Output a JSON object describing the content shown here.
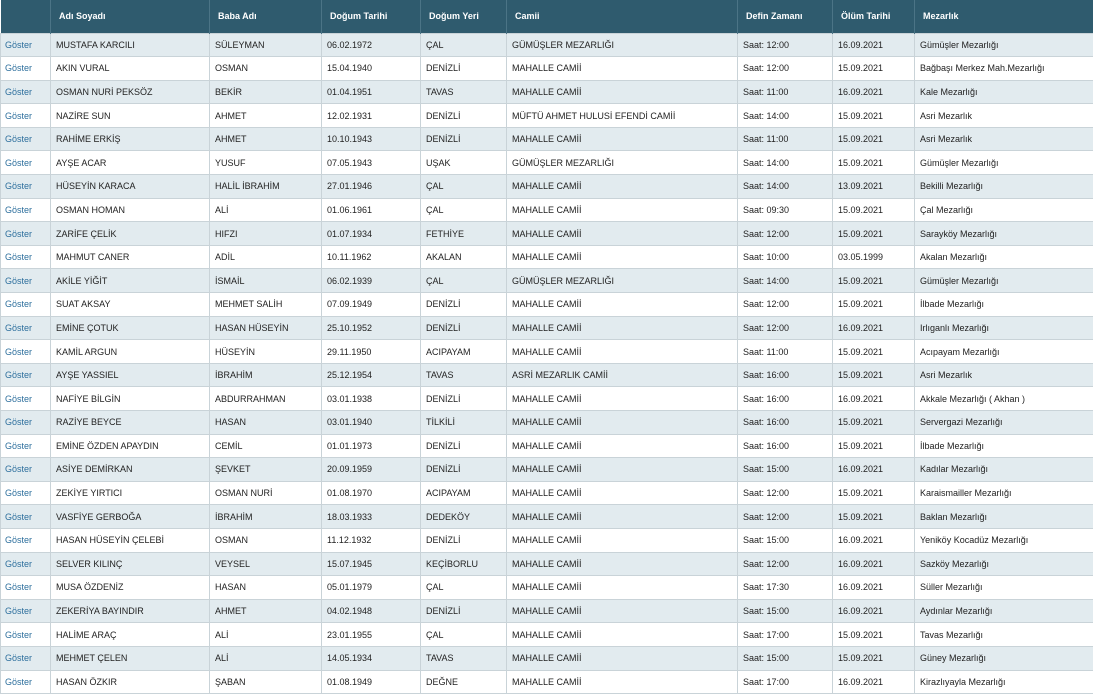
{
  "table": {
    "headers": [
      "",
      "Adı Soyadı",
      "Baba Adı",
      "Doğum Tarihi",
      "Doğum Yeri",
      "Camii",
      "Defin Zamanı",
      "Ölüm Tarihi",
      "Mezarlık"
    ],
    "link_label": "Göster",
    "rows": [
      [
        "MUSTAFA KARCILI",
        "SÜLEYMAN",
        "06.02.1972",
        "ÇAL",
        "GÜMÜŞLER MEZARLIĞI",
        "Saat: 12:00",
        "16.09.2021",
        "Gümüşler Mezarlığı"
      ],
      [
        "AKIN VURAL",
        "OSMAN",
        "15.04.1940",
        "DENİZLİ",
        "MAHALLE CAMİİ",
        "Saat: 12:00",
        "15.09.2021",
        "Bağbaşı Merkez Mah.Mezarlığı"
      ],
      [
        "OSMAN NURİ PEKSÖZ",
        "BEKİR",
        "01.04.1951",
        "TAVAS",
        "MAHALLE CAMİİ",
        "Saat: 11:00",
        "16.09.2021",
        "Kale Mezarlığı"
      ],
      [
        "NAZİRE SUN",
        "AHMET",
        "12.02.1931",
        "DENİZLİ",
        "MÜFTÜ AHMET HULUSİ EFENDİ CAMİİ",
        "Saat: 14:00",
        "15.09.2021",
        "Asri Mezarlık"
      ],
      [
        "RAHİME ERKİŞ",
        "AHMET",
        "10.10.1943",
        "DENİZLİ",
        "MAHALLE CAMİİ",
        "Saat: 11:00",
        "15.09.2021",
        "Asri Mezarlık"
      ],
      [
        "AYŞE ACAR",
        "YUSUF",
        "07.05.1943",
        "UŞAK",
        "GÜMÜŞLER MEZARLIĞI",
        "Saat: 14:00",
        "15.09.2021",
        "Gümüşler Mezarlığı"
      ],
      [
        "HÜSEYİN KARACA",
        "HALİL İBRAHİM",
        "27.01.1946",
        "ÇAL",
        "MAHALLE CAMİİ",
        "Saat: 14:00",
        "13.09.2021",
        "Bekilli Mezarlığı"
      ],
      [
        "OSMAN HOMAN",
        "ALİ",
        "01.06.1961",
        "ÇAL",
        "MAHALLE CAMİİ",
        "Saat: 09:30",
        "15.09.2021",
        "Çal Mezarlığı"
      ],
      [
        "ZARİFE ÇELİK",
        "HIFZI",
        "01.07.1934",
        "FETHİYE",
        "MAHALLE CAMİİ",
        "Saat: 12:00",
        "15.09.2021",
        "Sarayköy Mezarlığı"
      ],
      [
        "MAHMUT CANER",
        "ADİL",
        "10.11.1962",
        "AKALAN",
        "MAHALLE CAMİİ",
        "Saat: 10:00",
        "03.05.1999",
        "Akalan Mezarlığı"
      ],
      [
        "AKİLE YİĞİT",
        "İSMAİL",
        "06.02.1939",
        "ÇAL",
        "GÜMÜŞLER MEZARLIĞI",
        "Saat: 14:00",
        "15.09.2021",
        "Gümüşler Mezarlığı"
      ],
      [
        "SUAT AKSAY",
        "MEHMET SALİH",
        "07.09.1949",
        "DENİZLİ",
        "MAHALLE CAMİİ",
        "Saat: 12:00",
        "15.09.2021",
        "İlbade Mezarlığı"
      ],
      [
        "EMİNE ÇOTUK",
        "HASAN HÜSEYİN",
        "25.10.1952",
        "DENİZLİ",
        "MAHALLE CAMİİ",
        "Saat: 12:00",
        "16.09.2021",
        "Irlıganlı Mezarlığı"
      ],
      [
        "KAMİL ARGUN",
        "HÜSEYİN",
        "29.11.1950",
        "ACIPAYAM",
        "MAHALLE CAMİİ",
        "Saat: 11:00",
        "15.09.2021",
        "Acıpayam Mezarlığı"
      ],
      [
        "AYŞE YASSIEL",
        "İBRAHİM",
        "25.12.1954",
        "TAVAS",
        "ASRİ MEZARLIK CAMİİ",
        "Saat: 16:00",
        "15.09.2021",
        "Asri Mezarlık"
      ],
      [
        "NAFİYE BİLGİN",
        "ABDURRAHMAN",
        "03.01.1938",
        "DENİZLİ",
        "MAHALLE CAMİİ",
        "Saat: 16:00",
        "16.09.2021",
        "Akkale Mezarlığı ( Akhan )"
      ],
      [
        "RAZİYE BEYCE",
        "HASAN",
        "03.01.1940",
        "TİLKİLİ",
        "MAHALLE CAMİİ",
        "Saat: 16:00",
        "15.09.2021",
        "Servergazi Mezarlığı"
      ],
      [
        "EMİNE ÖZDEN APAYDIN",
        "CEMİL",
        "01.01.1973",
        "DENİZLİ",
        "MAHALLE CAMİİ",
        "Saat: 16:00",
        "15.09.2021",
        "İlbade Mezarlığı"
      ],
      [
        "ASİYE DEMİRKAN",
        "ŞEVKET",
        "20.09.1959",
        "DENİZLİ",
        "MAHALLE CAMİİ",
        "Saat: 15:00",
        "16.09.2021",
        "Kadılar Mezarlığı"
      ],
      [
        "ZEKİYE YIRTICI",
        "OSMAN NURİ",
        "01.08.1970",
        "ACIPAYAM",
        "MAHALLE CAMİİ",
        "Saat: 12:00",
        "15.09.2021",
        "Karaismailler Mezarlığı"
      ],
      [
        "VASFİYE GERBOĞA",
        "İBRAHİM",
        "18.03.1933",
        "DEDEKÖY",
        "MAHALLE CAMİİ",
        "Saat: 12:00",
        "15.09.2021",
        "Baklan Mezarlığı"
      ],
      [
        "HASAN HÜSEYİN ÇELEBİ",
        "OSMAN",
        "11.12.1932",
        "DENİZLİ",
        "MAHALLE CAMİİ",
        "Saat: 15:00",
        "16.09.2021",
        "Yeniköy Kocadüz Mezarlığı"
      ],
      [
        "SELVER KILINÇ",
        "VEYSEL",
        "15.07.1945",
        "KEÇİBORLU",
        "MAHALLE CAMİİ",
        "Saat: 12:00",
        "16.09.2021",
        "Sazköy Mezarlığı"
      ],
      [
        "MUSA ÖZDENİZ",
        "HASAN",
        "05.01.1979",
        "ÇAL",
        "MAHALLE CAMİİ",
        "Saat: 17:30",
        "16.09.2021",
        "Süller Mezarlığı"
      ],
      [
        "ZEKERİYA BAYINDIR",
        "AHMET",
        "04.02.1948",
        "DENİZLİ",
        "MAHALLE CAMİİ",
        "Saat: 15:00",
        "16.09.2021",
        "Aydınlar Mezarlığı"
      ],
      [
        "HALİME ARAÇ",
        "ALİ",
        "23.01.1955",
        "ÇAL",
        "MAHALLE CAMİİ",
        "Saat: 17:00",
        "15.09.2021",
        "Tavas Mezarlığı"
      ],
      [
        "MEHMET ÇELEN",
        "ALİ",
        "14.05.1934",
        "TAVAS",
        "MAHALLE CAMİİ",
        "Saat: 15:00",
        "15.09.2021",
        "Güney Mezarlığı"
      ],
      [
        "HASAN ÖZKIR",
        "ŞABAN",
        "01.08.1949",
        "DEĞNE",
        "MAHALLE CAMİİ",
        "Saat: 17:00",
        "16.09.2021",
        "Kirazlıyayla Mezarlığı"
      ]
    ]
  }
}
